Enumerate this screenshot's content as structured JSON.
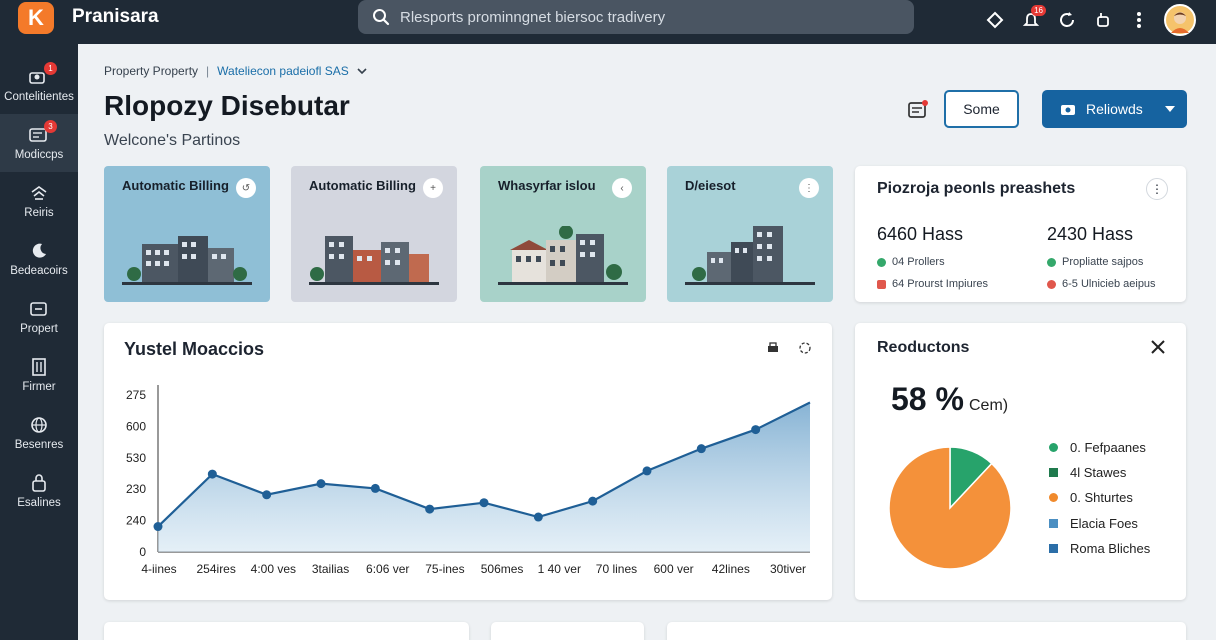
{
  "app": {
    "logo_letter": "K",
    "title": "Pranisara"
  },
  "search": {
    "placeholder": "Rlesports prominngnet biersoc tradivery"
  },
  "topbar": {
    "notification_badge": "16"
  },
  "sidebar": {
    "items": [
      {
        "label": "Contelitientes",
        "icon": "users-icon",
        "badge": "1"
      },
      {
        "label": "Modiccps",
        "icon": "modules-icon",
        "badge": "3"
      },
      {
        "label": "Reiris",
        "icon": "wifi-icon"
      },
      {
        "label": "Bedeacoirs",
        "icon": "moon-icon"
      },
      {
        "label": "Propert",
        "icon": "property-icon"
      },
      {
        "label": "Firmer",
        "icon": "building-icon"
      },
      {
        "label": "Besenres",
        "icon": "globe-icon"
      },
      {
        "label": "Esalines",
        "icon": "lock-icon"
      }
    ]
  },
  "header": {
    "breadcrumb_1": "Property Property",
    "breadcrumb_sep": "|",
    "breadcrumb_2": "Wateliecon padeiofl SAS",
    "title": "Rlopozy Disebutar",
    "subtitle": "Welcone's Partinos",
    "some_button": "Some",
    "primary_button": "Reliowds"
  },
  "property_cards": [
    {
      "title": "Automatic Billing",
      "bg": "#8fbfd6",
      "btn": "↺"
    },
    {
      "title": "Automatic Billing",
      "bg": "#d3d6df",
      "btn": "+"
    },
    {
      "title": "Whasyrfar islou",
      "bg": "#a8d2c9",
      "btn": "‹"
    },
    {
      "title": "D/eiesot",
      "bg": "#a9d2d8",
      "btn": "⋮"
    }
  ],
  "stats": {
    "title": "Piozroja peonls preashets",
    "left_value": "6460 Hass",
    "left_rows": [
      "04 Prollers",
      "64 Prourst Impiures"
    ],
    "right_value": "2430 Hass",
    "right_rows": [
      "Propliatte sajpos",
      "6-5 Ulnicieb aeipus"
    ]
  },
  "line_chart": {
    "title": "Yustel Moaccios"
  },
  "chart_data": {
    "type": "area",
    "title": "Yustel Moaccios",
    "y_tick_labels": [
      "275",
      "600",
      "530",
      "230",
      "240",
      "0"
    ],
    "x_tick_labels": [
      "4-iines",
      "254ires",
      "4:00 ves",
      "3tailias",
      "6:06 ver",
      "75-ines",
      "506mes",
      "1 40 ver",
      "70 lines",
      "600 ver",
      "42lines",
      "30tiver"
    ],
    "y": [
      0.16,
      0.49,
      0.36,
      0.43,
      0.4,
      0.27,
      0.31,
      0.22,
      0.32,
      0.51,
      0.65,
      0.77,
      0.94
    ],
    "y_scale": "fraction of plot height",
    "grid": false,
    "color": "#1f5f96"
  },
  "reductions": {
    "title": "Reoductons",
    "percent": "58 %",
    "percent_unit": "Cem)",
    "legend": [
      {
        "label": "0. Fefpaanes",
        "color": "#27a36b",
        "shape": "circle"
      },
      {
        "label": "4l Stawes",
        "color": "#1f7a4d",
        "shape": "square"
      },
      {
        "label": "0. Shturtes",
        "color": "#f08a2c",
        "shape": "circle"
      },
      {
        "label": "Elacia Foes",
        "color": "#4b8fc2",
        "shape": "square"
      },
      {
        "label": "Roma Bliches",
        "color": "#2b6ea8",
        "shape": "square"
      }
    ],
    "pie": [
      {
        "value": 12,
        "color": "#27a36b"
      },
      {
        "value": 88,
        "color": "#f4913a"
      }
    ]
  },
  "bottom_card_titles": [
    "",
    "",
    ""
  ]
}
